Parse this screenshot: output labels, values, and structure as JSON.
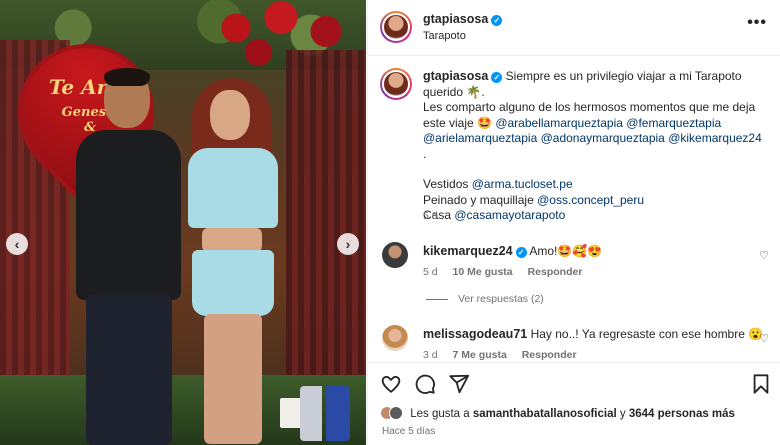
{
  "photo": {
    "sign_line1": "Te Amo",
    "sign_line2": "Genesis",
    "sign_line3": "&"
  },
  "header": {
    "username": "gtapiasosa",
    "location": "Tarapoto",
    "more_glyph": "•••"
  },
  "caption": {
    "username": "gtapiasosa",
    "text1": "Siempre es un privilegio viajar a mi Tarapoto",
    "text2": "querido 🌴.",
    "text3": "Les comparto alguno de los hermosos momentos que me deja",
    "text4": "este viaje 🤩",
    "mention1": "@arabellamarqueztapia",
    "mention2": "@femarqueztapia",
    "mention3": "@arielamarqueztapia",
    "mention4": "@adonaymarqueztapia",
    "mention5": "@kikemarquez24",
    "period": ".",
    "vestidos_label": "Vestidos",
    "vestidos_link": "@arma.tucloset.pe",
    "peinado_label": "Peinado y maquillaje",
    "peinado_link": "@oss.concept_peru",
    "casa_label": "Casa",
    "casa_link": "@casamayotarapoto",
    "time": "5 d"
  },
  "comments": [
    {
      "username": "kikemarquez24",
      "text": "Amo!🤩🥰😍",
      "time": "5 d",
      "likes": "10 Me gusta",
      "reply": "Responder"
    },
    {
      "username": "melissagodeau71",
      "text": "Hay no..! Ya regresaste con ese hombre 😮",
      "time": "3 d",
      "likes": "7 Me gusta",
      "reply": "Responder"
    }
  ],
  "replies_link": "Ver respuestas (2)",
  "likes": {
    "prefix": "Les gusta a",
    "user": "samanthabatallanosoficial",
    "middle": "y",
    "others": "3644 personas más"
  },
  "date": "Hace 5 días",
  "icons": [
    "chevron-left-icon",
    "chevron-right-icon",
    "verified-icon",
    "more-icon",
    "heart-icon",
    "comment-icon",
    "share-icon",
    "bookmark-icon"
  ]
}
